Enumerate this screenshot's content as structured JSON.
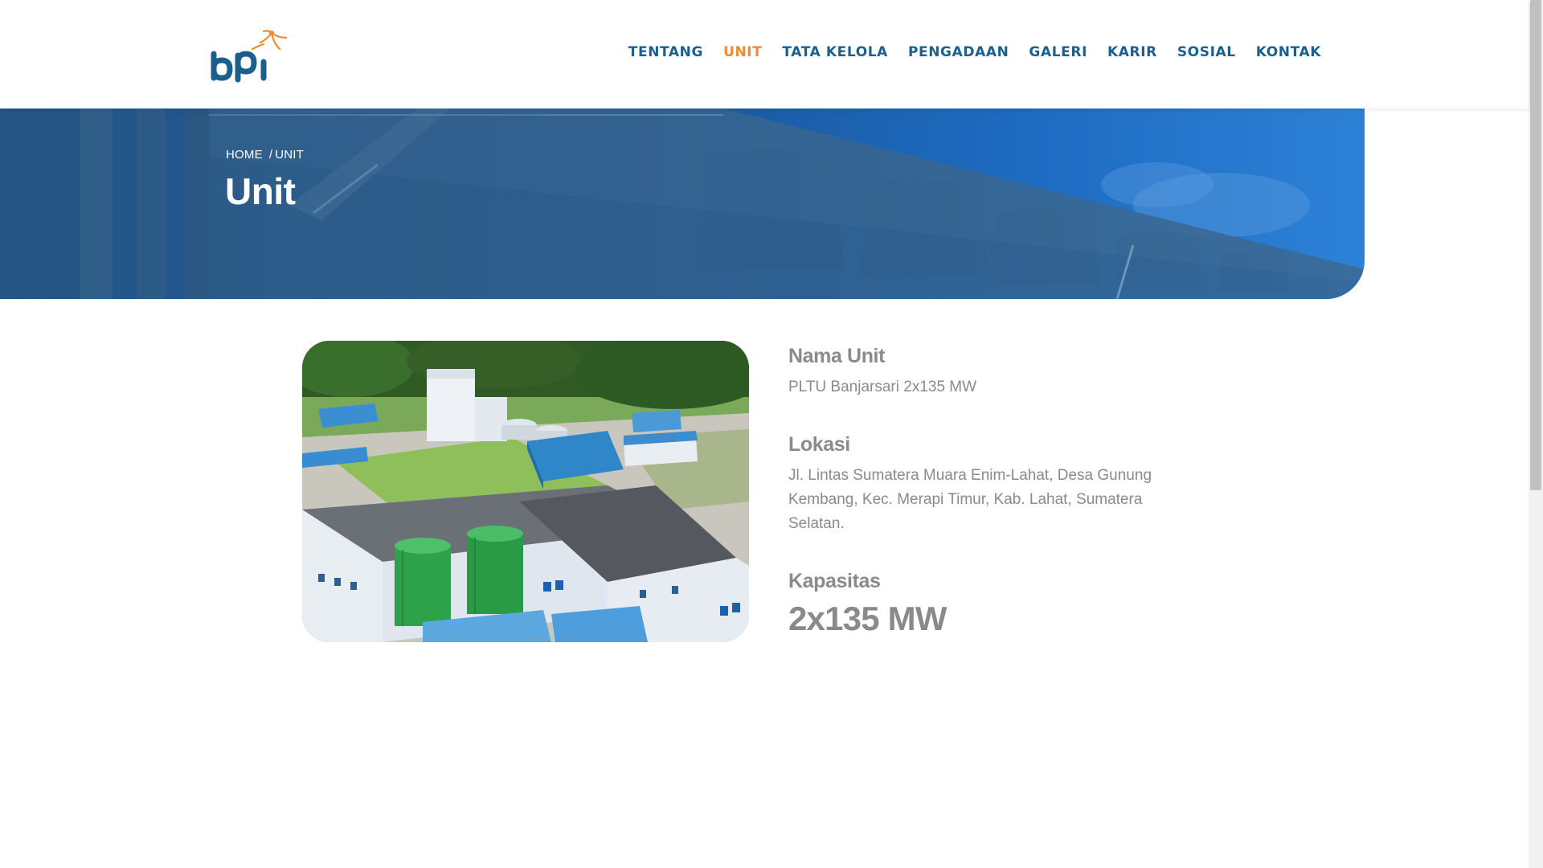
{
  "header": {
    "logo_text": "bpi",
    "nav": [
      {
        "label": "TENTANG",
        "active": false
      },
      {
        "label": "UNIT",
        "active": true
      },
      {
        "label": "TATA KELOLA",
        "active": false
      },
      {
        "label": "PENGADAAN",
        "active": false
      },
      {
        "label": "GALERI",
        "active": false
      },
      {
        "label": "KARIR",
        "active": false
      },
      {
        "label": "SOSIAL",
        "active": false
      },
      {
        "label": "KONTAK",
        "active": false
      }
    ]
  },
  "hero": {
    "breadcrumb_home": "HOME",
    "breadcrumb_separator": "/",
    "breadcrumb_current": "UNIT",
    "title": "Unit"
  },
  "unit": {
    "name_label": "Nama Unit",
    "name_value": "PLTU Banjarsari 2x135 MW",
    "location_label": "Lokasi",
    "location_value": "Jl. Lintas Sumatera Muara Enim-Lahat, Desa Gunung Kembang, Kec. Merapi Timur, Kab. Lahat, Sumatera Selatan.",
    "capacity_label": "Kapasitas",
    "capacity_value": "2x135 MW"
  },
  "colors": {
    "nav": "#1d5f8c",
    "nav_active": "#f08c2d",
    "text_gray": "#8a8a8a",
    "logo_blue": "#1d5f8c",
    "logo_orange": "#f08c2d"
  }
}
